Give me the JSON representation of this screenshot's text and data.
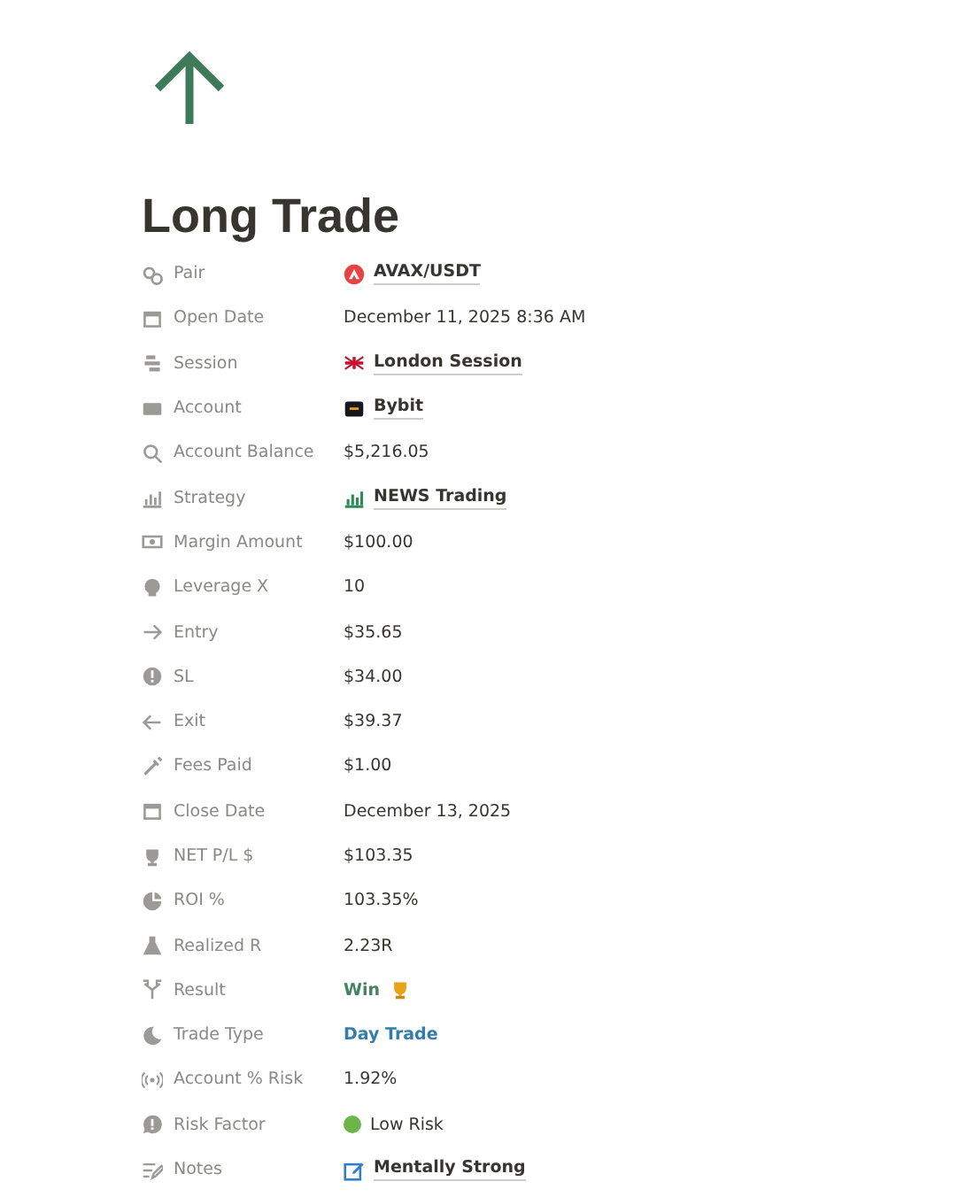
{
  "title": "Long Trade",
  "properties": [
    {
      "label": "Pair",
      "kind": "link",
      "value": "AVAX/USDT"
    },
    {
      "label": "Open Date",
      "kind": "plain",
      "value": "December 11, 2025 8:36 AM"
    },
    {
      "label": "Session",
      "kind": "link",
      "value": "London Session"
    },
    {
      "label": "Account",
      "kind": "link",
      "value": "Bybit"
    },
    {
      "label": "Account Balance",
      "kind": "plain",
      "value": "$5,216.05"
    },
    {
      "label": "Strategy",
      "kind": "link",
      "value": "NEWS Trading"
    },
    {
      "label": "Margin Amount",
      "kind": "plain",
      "value": "$100.00"
    },
    {
      "label": "Leverage X",
      "kind": "plain",
      "value": "10"
    },
    {
      "label": "Entry",
      "kind": "plain",
      "value": "$35.65"
    },
    {
      "label": "SL",
      "kind": "plain",
      "value": "$34.00"
    },
    {
      "label": "Exit",
      "kind": "plain",
      "value": "$39.37"
    },
    {
      "label": "Fees Paid",
      "kind": "plain",
      "value": "$1.00"
    },
    {
      "label": "Close Date",
      "kind": "plain",
      "value": "December 13, 2025"
    },
    {
      "label": "NET P/L $",
      "kind": "plain",
      "value": "$103.35"
    },
    {
      "label": "ROI %",
      "kind": "plain",
      "value": "103.35%"
    },
    {
      "label": "Realized R",
      "kind": "plain",
      "value": "2.23R"
    },
    {
      "label": "Result",
      "kind": "tag",
      "value": "Win",
      "color": "#448361"
    },
    {
      "label": "Trade Type",
      "kind": "tag",
      "value": "Day Trade",
      "color": "#337ea9"
    },
    {
      "label": "Account % Risk",
      "kind": "plain",
      "value": "1.92%"
    },
    {
      "label": "Risk Factor",
      "kind": "dot",
      "value": "Low Risk",
      "color": "#6cb54a"
    },
    {
      "label": "Notes",
      "kind": "link",
      "value": "Mentally Strong"
    }
  ]
}
